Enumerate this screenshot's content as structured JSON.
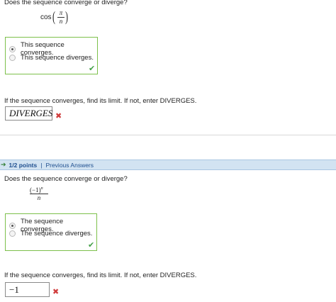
{
  "q1": {
    "question": "Does the sequence converge or diverge?",
    "expr": {
      "fn": "cos",
      "num": "π",
      "den": "n"
    },
    "choices": [
      {
        "label": "This sequence converges.",
        "selected": true
      },
      {
        "label": "This sequence diverges.",
        "selected": false
      }
    ],
    "check_icon": "checkmark-icon",
    "prompt": "If the sequence converges, find its limit. If not, enter DIVERGES.",
    "answer": "DIVERGES",
    "x_icon": "x-mark-icon"
  },
  "part_bar": {
    "arrow": "➔",
    "points": "1/2 points",
    "separator": "|",
    "previous": "Previous Answers"
  },
  "q2": {
    "question": "Does the sequence converge or diverge?",
    "expr": {
      "num_base": "(−1)",
      "num_exp": "n",
      "den": "n"
    },
    "choices": [
      {
        "label": "The sequence converges.",
        "selected": true
      },
      {
        "label": "The sequence diverges.",
        "selected": false
      }
    ],
    "check_icon": "checkmark-icon",
    "prompt": "If the sequence converges, find its limit. If not, enter DIVERGES.",
    "answer": "−1",
    "x_icon": "x-mark-icon"
  },
  "colors": {
    "correct_border": "#7dc04b",
    "check": "#43a047",
    "wrong": "#d03b3b",
    "bar_bg": "#d2e3f2",
    "link": "#1f4f8f"
  }
}
